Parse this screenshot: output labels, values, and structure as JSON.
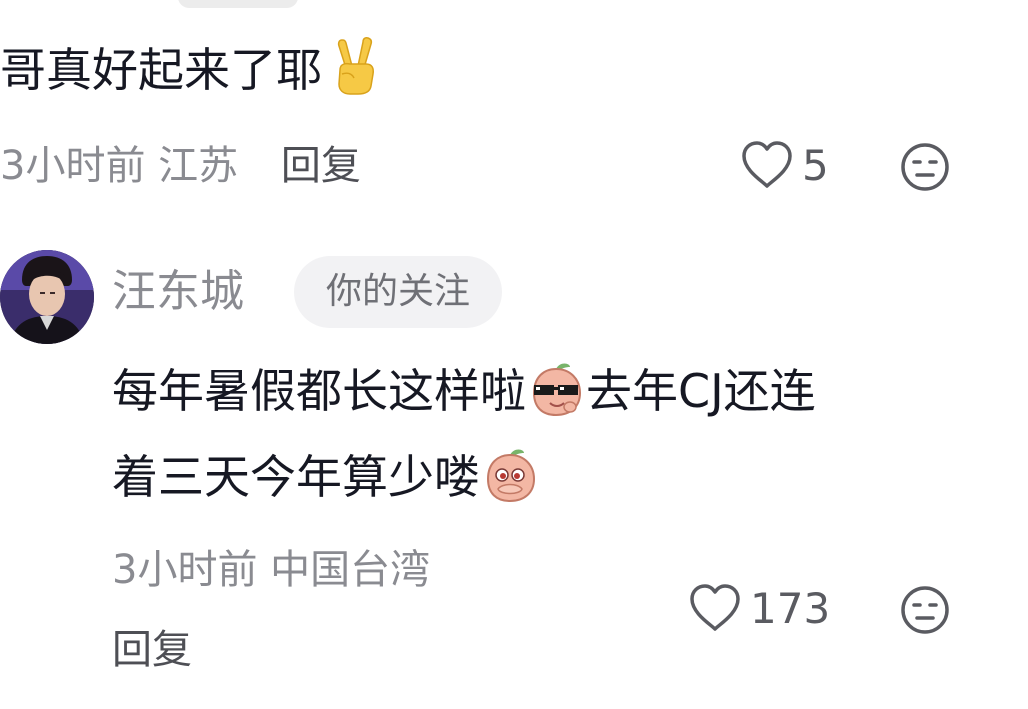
{
  "comment1": {
    "text": "哥真好起来了耶",
    "emoji": "victory-hand-emoji",
    "time": "3小时前",
    "location": "江苏",
    "reply_label": "回复",
    "like_count": "5"
  },
  "comment2": {
    "username": "汪东城",
    "badge": "你的关注",
    "line1_a": "每年暑假都长这样啦",
    "line1_b": "去年CJ还连",
    "line2": "着三天今年算少喽",
    "emoji_a": "peach-sunglasses-emoji",
    "emoji_b": "peach-covering-mouth-emoji",
    "time": "3小时前",
    "location": "中国台湾",
    "reply_label": "回复",
    "like_count": "173"
  },
  "colors": {
    "text_primary": "#161823",
    "text_secondary": "#8a8b91",
    "icon": "#5a5b61",
    "badge_bg": "#f2f2f4"
  }
}
